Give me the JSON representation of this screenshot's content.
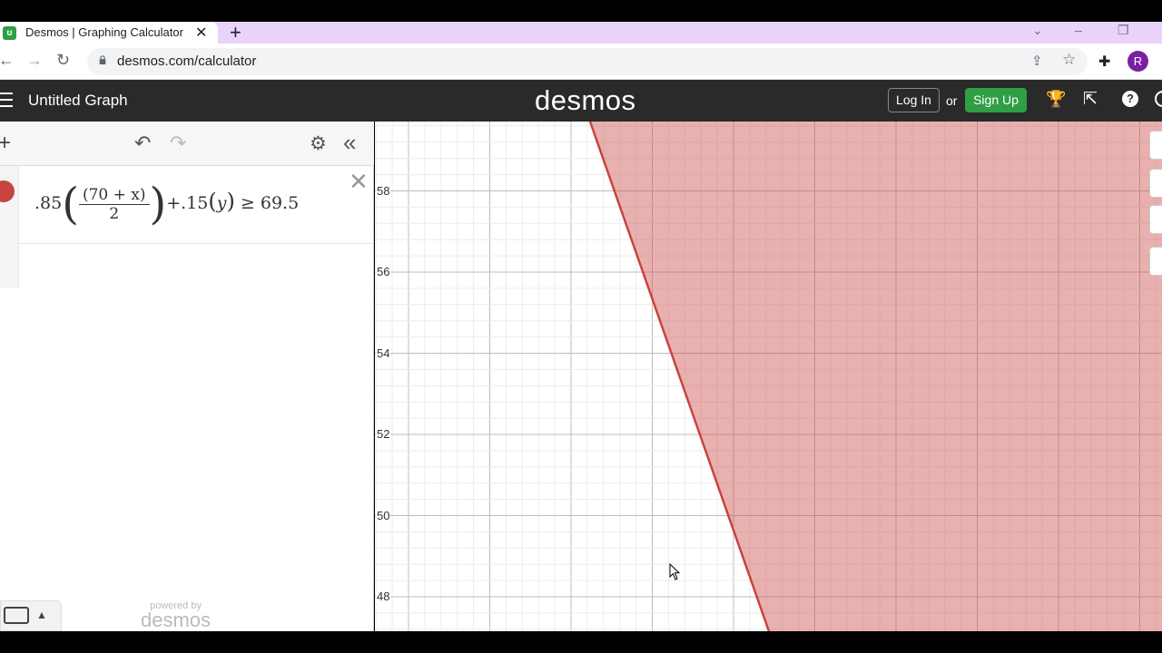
{
  "browser": {
    "tab_title": "Desmos | Graphing Calculator",
    "url": "desmos.com/calculator",
    "profile_initial": "R"
  },
  "header": {
    "graph_title": "Untitled Graph",
    "logo": "desmos",
    "login_label": "Log In",
    "or_text": "or",
    "signup_label": "Sign Up"
  },
  "expressions": [
    {
      "lhs_coef": ".85",
      "numerator": "(70 + x)",
      "denominator": "2",
      "rhs_part": "+.15",
      "var_y": "y",
      "relation": "≥",
      "constant": "69.5",
      "color": "#c74440"
    }
  ],
  "branding": {
    "powered_by": "powered by",
    "logo": "desmos"
  },
  "graph": {
    "y_ticks": [
      "58",
      "56",
      "54",
      "52",
      "50",
      "48"
    ],
    "shade_color": "#c74440",
    "icons": [
      "wrench-icon",
      "zoom-in-icon",
      "zoom-out-icon",
      "home-icon"
    ]
  }
}
